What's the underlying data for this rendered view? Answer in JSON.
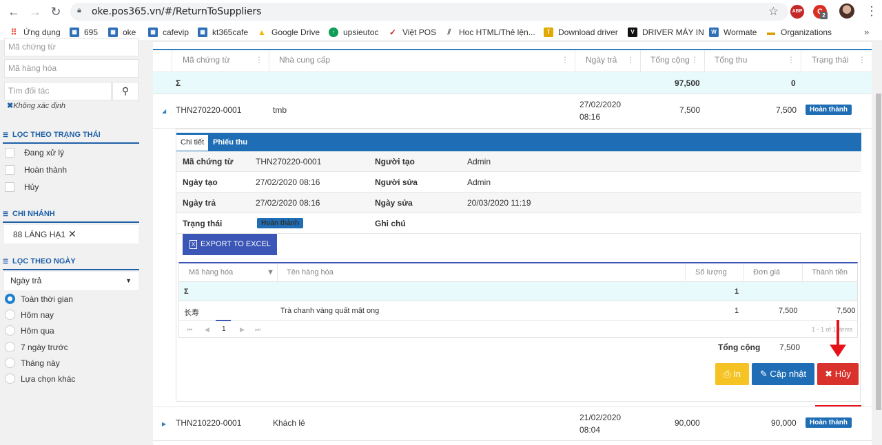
{
  "browser": {
    "url": "oke.pos365.vn/#/ReturnToSuppliers",
    "back_icon": "arrow-left-icon",
    "forward_icon": "arrow-right-icon",
    "reload_icon": "reload-icon",
    "lock_icon": "lock-icon",
    "star_icon": "star-icon",
    "ext_abp": "ABP",
    "ext_badge": "2",
    "bookmarks": [
      {
        "label": "Ứng dụng",
        "color": "#e94235"
      },
      {
        "label": "695",
        "color": "#2f6fb7"
      },
      {
        "label": "oke",
        "color": "#2f6fb7"
      },
      {
        "label": "cafevip",
        "color": "#2f6fb7"
      },
      {
        "label": "kt365cafe",
        "color": "#2f6fb7"
      },
      {
        "label": "Google Drive",
        "color": "#f4b400"
      },
      {
        "label": "upsieutoc",
        "color": "#0f9d58"
      },
      {
        "label": "Việt POS",
        "color": "#c62828"
      },
      {
        "label": "Hoc HTML/Thẻ lện...",
        "color": "#555555"
      },
      {
        "label": "Download driver",
        "color": "#e0a800"
      },
      {
        "label": "DRIVER MÁY IN",
        "color": "#111111"
      },
      {
        "label": "Wormate",
        "color": "#2f6fb7"
      },
      {
        "label": "Organizations",
        "color": "#d8a000"
      }
    ]
  },
  "sidebar": {
    "doc_code_placeholder": "Mã chứng từ",
    "item_code_placeholder": "Mã hàng hóa",
    "partner_placeholder": "Tìm đối tác",
    "unknown_tag": "Không xác định",
    "status_section": "LỌC THEO TRẠNG THÁI",
    "status_options": [
      "Đang xử lý",
      "Hoàn thành",
      "Hủy"
    ],
    "branch_section": "CHI NHÁNH",
    "branch_value": "88 LÁNG HẠ1",
    "date_section": "LỌC THEO NGÀY",
    "date_type": "Ngày trả",
    "date_options": [
      "Toàn thời gian",
      "Hôm nay",
      "Hôm qua",
      "7 ngày trước",
      "Tháng này",
      "Lựa chọn khác"
    ]
  },
  "grid": {
    "columns": [
      "Mã chứng từ",
      "Nhà cung cấp",
      "Ngày trả",
      "Tổng cộng",
      "Tổng thu",
      "Trạng thái"
    ],
    "sum_symbol": "Σ",
    "sum_total": "97,500",
    "sum_paid": "0",
    "rows": [
      {
        "code": "THN270220-0001",
        "supplier": "tmb",
        "date": "27/02/2020",
        "time": "08:16",
        "total": "7,500",
        "paid": "7,500",
        "status": "Hoàn thành"
      },
      {
        "code": "THN210220-0001",
        "supplier": "Khách lẻ",
        "date": "21/02/2020",
        "time": "08:04",
        "total": "90,000",
        "paid": "90,000",
        "status": "Hoàn thành"
      }
    ]
  },
  "detail": {
    "tab_detail": "Chi tiết",
    "tab_receipt": "Phiếu thu",
    "doc_code_label": "Mã chứng từ",
    "doc_code": "THN270220-0001",
    "creator_label": "Người tạo",
    "creator": "Admin",
    "created_label": "Ngày tạo",
    "created": "27/02/2020 08:16",
    "editor_label": "Người sửa",
    "editor": "Admin",
    "return_label": "Ngày trả",
    "return_date": "27/02/2020 08:16",
    "edited_label": "Ngày sửa",
    "edited": "20/03/2020 11:19",
    "status_label": "Trạng thái",
    "status": "Hoàn thành",
    "note_label": "Ghi chú",
    "export_label": "EXPORT TO EXCEL",
    "items_columns": [
      "Mã hàng hóa",
      "Tên hàng hóa",
      "Số lượng",
      "Đơn giá",
      "Thành tiền"
    ],
    "items_sum_symbol": "Σ",
    "items_sum_qty": "1",
    "items": [
      {
        "code": "长寿",
        "name": "Trà chanh vàng quất mật ong",
        "qty": "1",
        "price": "7,500",
        "amount": "7,500"
      }
    ],
    "pager_page": "1",
    "pager_info": "1 - 1 of 1 items",
    "total_label": "Tổng cộng",
    "total_value": "7,500",
    "print_label": "In",
    "update_label": "Cập nhật",
    "cancel_label": "Hủy"
  }
}
